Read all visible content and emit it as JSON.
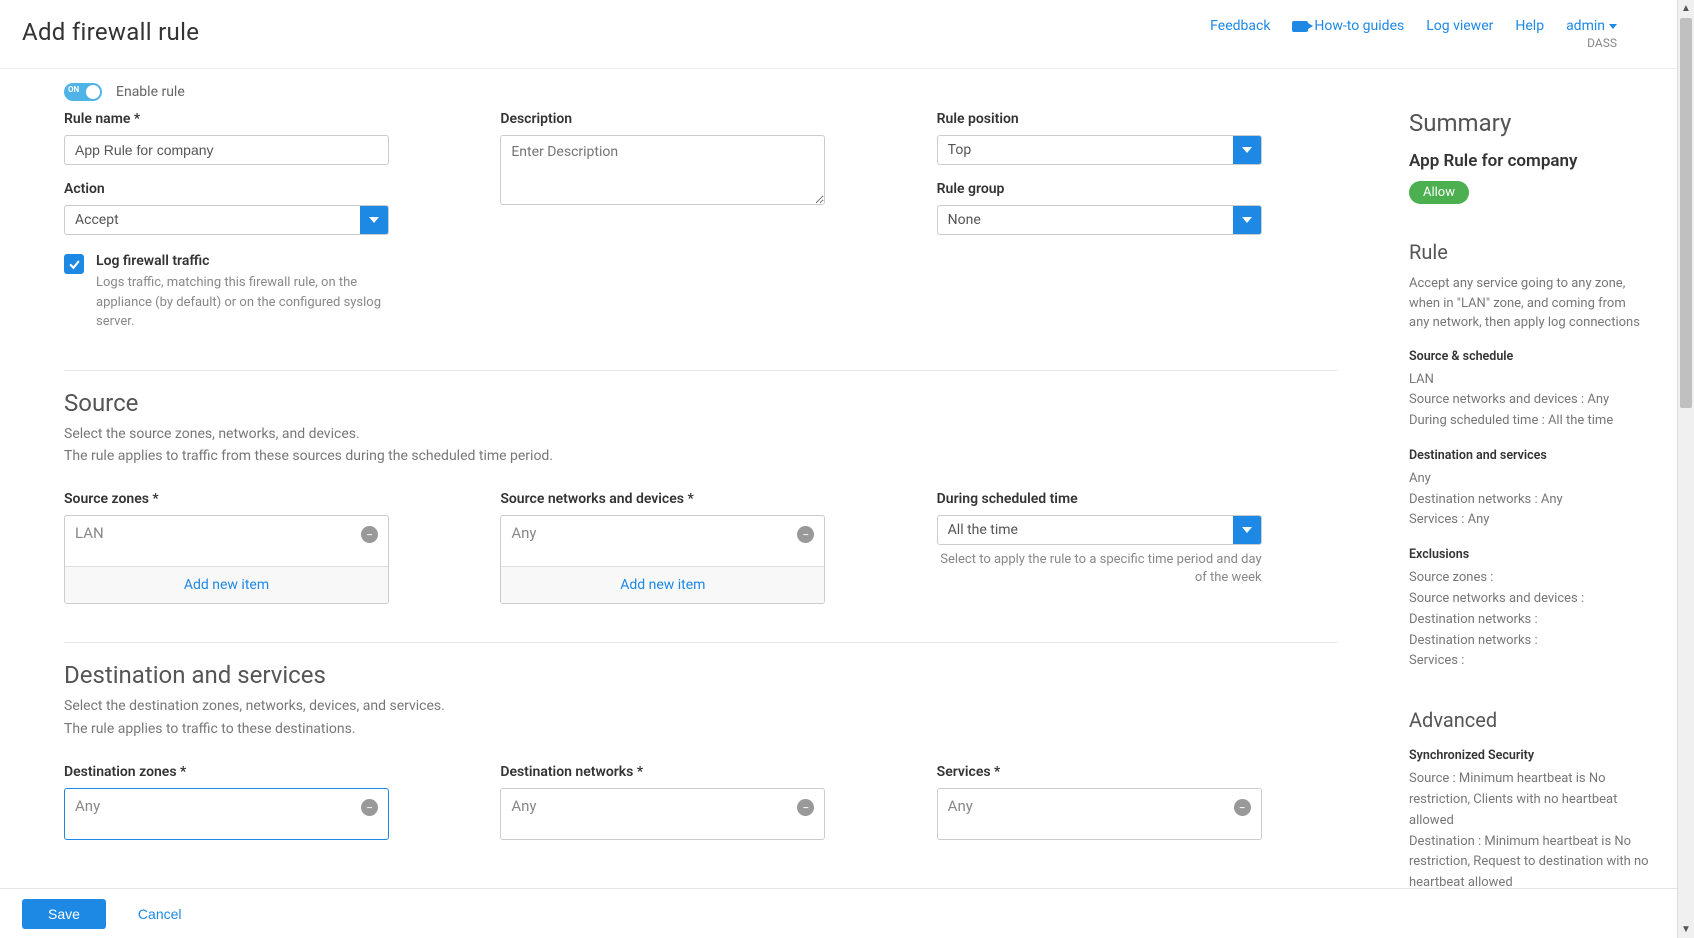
{
  "header": {
    "title": "Add firewall rule",
    "links": {
      "feedback": "Feedback",
      "howto": "How-to guides",
      "logviewer": "Log viewer",
      "help": "Help"
    },
    "admin": {
      "name": "admin",
      "org": "DASS"
    }
  },
  "toggle": {
    "label": "Enable rule"
  },
  "form": {
    "rule_name": {
      "label": "Rule name *",
      "value": "App Rule for company"
    },
    "description": {
      "label": "Description",
      "placeholder": "Enter Description"
    },
    "rule_position": {
      "label": "Rule position",
      "value": "Top"
    },
    "action": {
      "label": "Action",
      "value": "Accept"
    },
    "rule_group": {
      "label": "Rule group",
      "value": "None"
    },
    "log_traffic": {
      "label": "Log firewall traffic",
      "desc": "Logs traffic, matching this firewall rule, on the appliance (by default) or on the configured syslog server."
    }
  },
  "source": {
    "title": "Source",
    "desc1": "Select the source zones, networks, and devices.",
    "desc2": "The rule applies to traffic from these sources during the scheduled time period.",
    "zones": {
      "label": "Source zones *",
      "item": "LAN",
      "add": "Add new item"
    },
    "networks": {
      "label": "Source networks and devices *",
      "item": "Any",
      "add": "Add new item"
    },
    "schedule": {
      "label": "During scheduled time",
      "value": "All the time",
      "helper": "Select to apply the rule to a specific time period and day of the week"
    }
  },
  "destination": {
    "title": "Destination and services",
    "desc1": "Select the destination zones, networks, devices, and services.",
    "desc2": "The rule applies to traffic to these destinations.",
    "zones": {
      "label": "Destination zones *",
      "item": "Any"
    },
    "networks": {
      "label": "Destination networks *",
      "item": "Any"
    },
    "services": {
      "label": "Services *",
      "item": "Any"
    }
  },
  "summary": {
    "title": "Summary",
    "rule_name": "App Rule for company",
    "badge": "Allow",
    "rule": {
      "title": "Rule",
      "desc": "Accept any service going to any zone, when in \"LAN\" zone, and coming from any network, then apply log connections",
      "ss_head": "Source & schedule",
      "ss_lines": [
        "LAN",
        "Source networks and devices : Any",
        "During scheduled time : All the time"
      ],
      "ds_head": "Destination and services",
      "ds_lines": [
        "Any",
        "Destination networks : Any",
        "Services : Any"
      ],
      "ex_head": "Exclusions",
      "ex_lines": [
        "Source zones :",
        "Source networks and devices :",
        "Destination networks :",
        "Destination networks :",
        "Services :"
      ]
    },
    "advanced": {
      "title": "Advanced",
      "sync_head": "Synchronized Security",
      "sync_lines": [
        "Source : Minimum heartbeat is No restriction, Clients with no heartbeat allowed",
        "Destination : Minimum heartbeat is No restriction, Request to destination with no heartbeat allowed"
      ]
    }
  },
  "footer": {
    "save": "Save",
    "cancel": "Cancel"
  }
}
